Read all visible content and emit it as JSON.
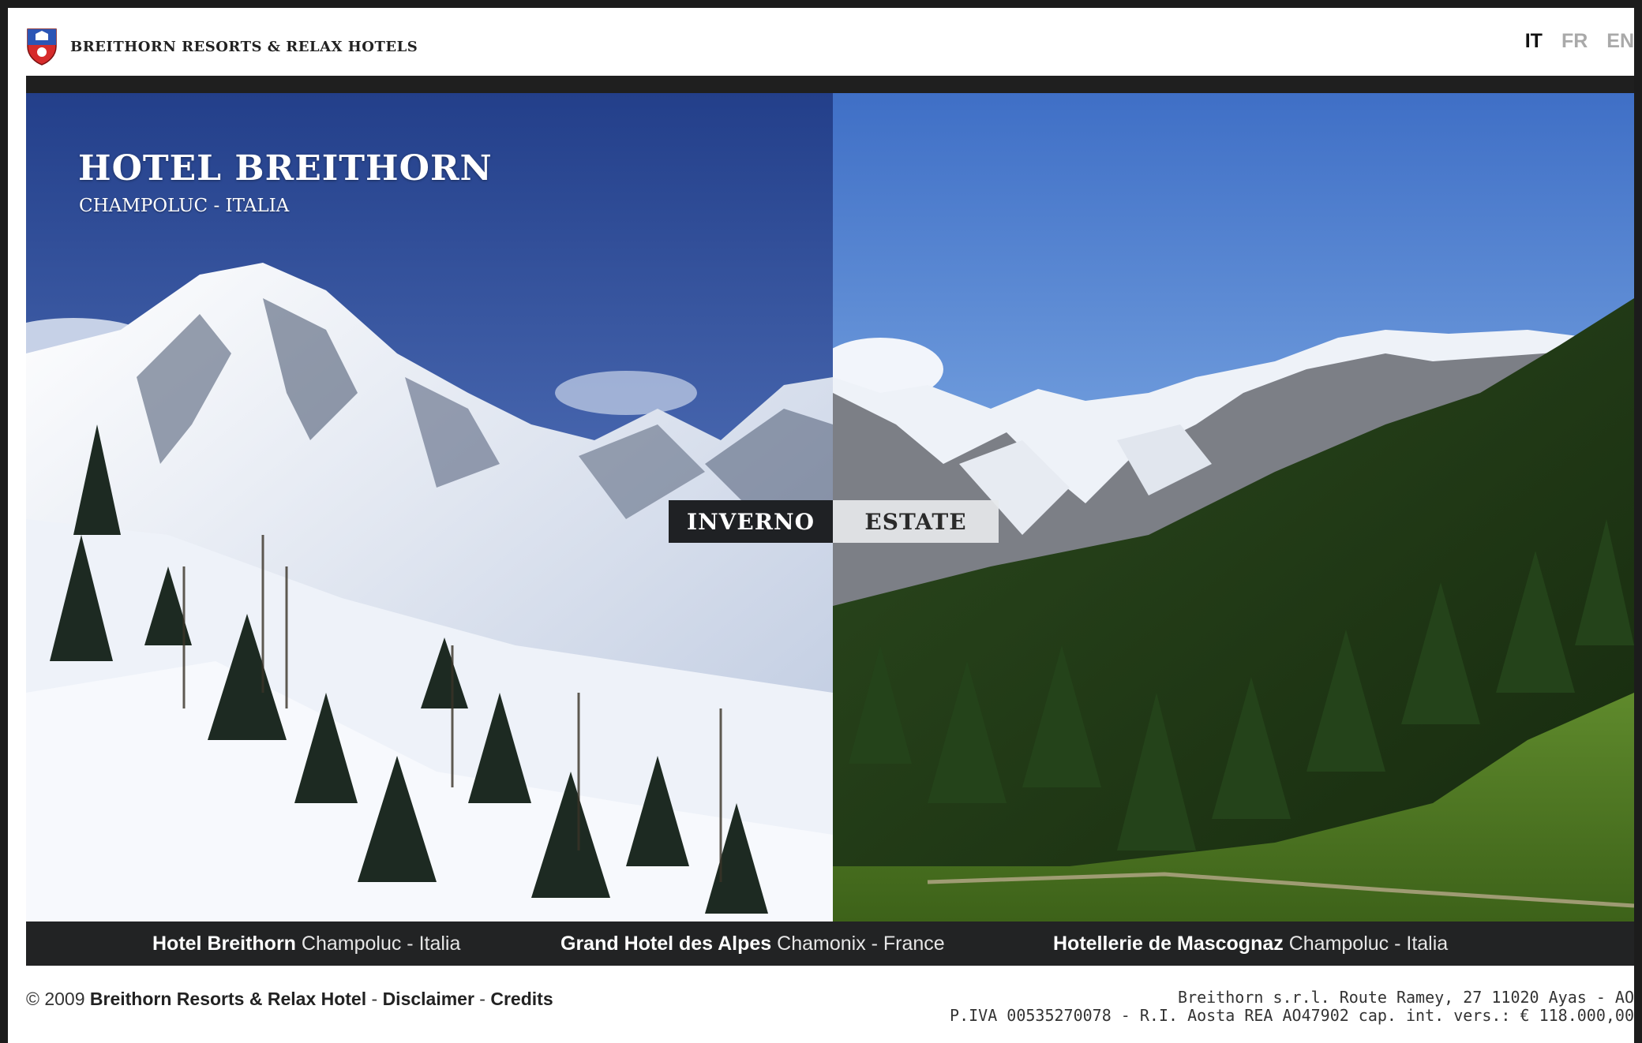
{
  "header": {
    "brand": "BREITHORN RESORTS & RELAX HOTELS",
    "languages": [
      {
        "code": "IT",
        "active": true
      },
      {
        "code": "FR",
        "active": false
      },
      {
        "code": "EN",
        "active": false
      }
    ]
  },
  "hero": {
    "title": "HOTEL BREITHORN",
    "subtitle": "CHAMPOLUC - ITALIA",
    "seasons": [
      "INVERNO",
      "ESTATE"
    ]
  },
  "hotels": [
    {
      "name": "Hotel Breithorn",
      "location": "Champoluc - Italia"
    },
    {
      "name": "Grand Hotel des Alpes",
      "location": "Chamonix - France"
    },
    {
      "name": "Hotellerie de Mascognaz",
      "location": "Champoluc - Italia"
    }
  ],
  "footer": {
    "copyright": "© 2009",
    "links": [
      "Breithorn Resorts & Relax Hotel",
      "Disclaimer",
      "Credits"
    ],
    "separator": " - ",
    "address_line1": "Breithorn s.r.l. Route Ramey, 27 11020 Ayas - AO",
    "address_line2": "P.IVA 00535270078 - R.I. Aosta REA AO47902 cap. int. vers.: € 118.000,00"
  },
  "colors": {
    "bar": "#222324",
    "winter_sky": "#2b4a94",
    "summer_sky": "#4c7ecf",
    "forest": "#1e3a14"
  }
}
